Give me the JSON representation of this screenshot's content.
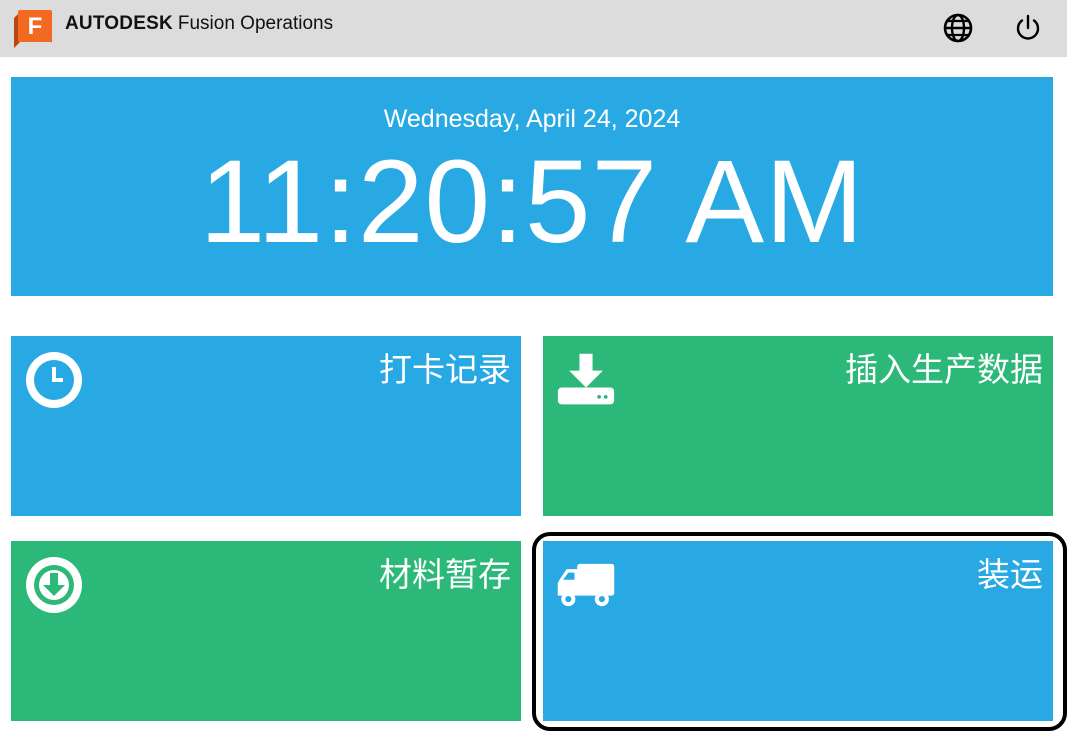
{
  "header": {
    "brand_bold": "AUTODESK",
    "brand_product": "Fusion Operations",
    "logo_letter": "F",
    "logo_icon": "autodesk-fusion-logo",
    "language_icon": "globe-icon",
    "power_icon": "power-icon"
  },
  "clock": {
    "date": "Wednesday, April 24, 2024",
    "time": "11:20:57 AM"
  },
  "tiles": [
    {
      "label": "打卡记录",
      "icon": "clock-icon",
      "color": "#29a9e3"
    },
    {
      "label": "插入生产数据",
      "icon": "download-tray-icon",
      "color": "#2bb878"
    },
    {
      "label": "材料暂存",
      "icon": "download-circle-icon",
      "color": "#2bb878"
    },
    {
      "label": "装运",
      "icon": "truck-icon",
      "color": "#29a9e3"
    }
  ],
  "colors": {
    "topbar": "#dcdcdc",
    "blue": "#29a9e3",
    "green": "#2bb878",
    "logo_orange": "#f26a21"
  }
}
